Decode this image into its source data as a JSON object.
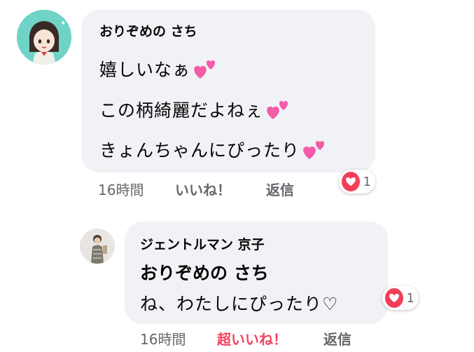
{
  "comment": {
    "author": "おりぞめの さち",
    "lines": [
      "嬉しいなぁ",
      "この柄綺麗だよねぇ",
      "きょんちゃんにぴったり"
    ],
    "time": "16時間",
    "like_label": "いいね！",
    "reply_label": "返信",
    "reaction_count": "1"
  },
  "reply": {
    "author": "ジェントルマン 京子",
    "mention": "おりぞめの さち",
    "text": "ね、わたしにぴったり♡",
    "time": "16時間",
    "like_label": "超いいね！",
    "reply_label": "返信",
    "reaction_count": "1"
  },
  "colors": {
    "bubble": "#f0f2f5",
    "meta_text": "#65676b",
    "love_red": "#f33e58",
    "super_like": "#f3425f",
    "avatar_bg": "#6fd3c7"
  },
  "icons": {
    "inline_emoji": "two-hearts-icon",
    "reaction": "love-reaction-icon"
  }
}
